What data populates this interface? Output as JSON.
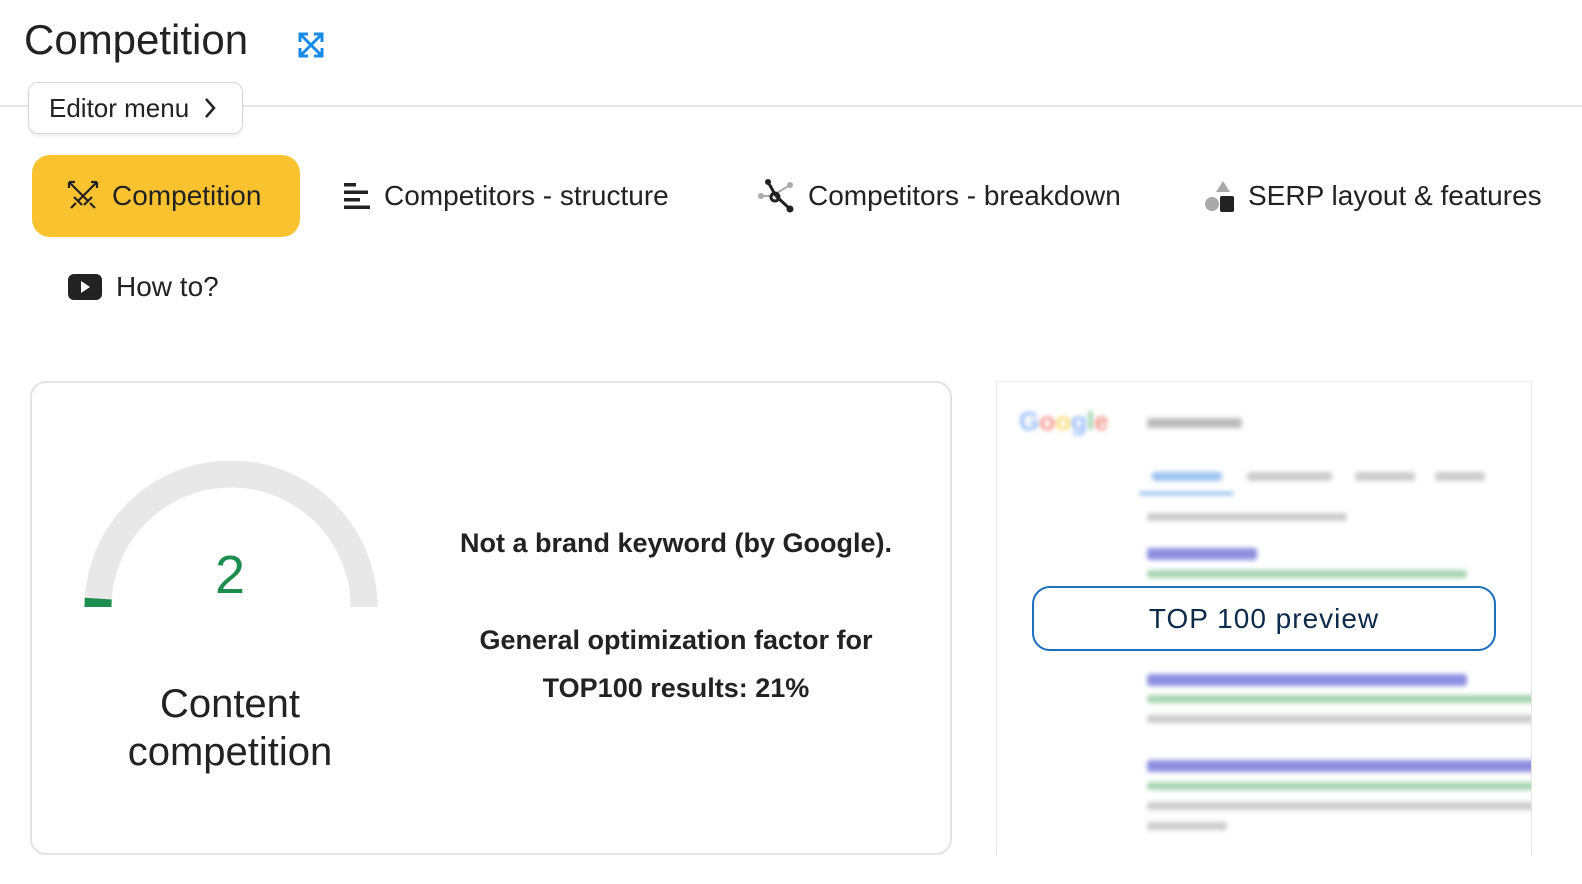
{
  "header": {
    "title": "Competition",
    "expand_icon": "expand-arrows-icon",
    "editor_menu": "Editor menu"
  },
  "tabs": [
    {
      "label": "Competition",
      "icon": "crossed-swords-icon",
      "active": true
    },
    {
      "label": "Competitors - structure",
      "icon": "align-left-lines-icon"
    },
    {
      "label": "Competitors - breakdown",
      "icon": "nodes-graph-icon"
    },
    {
      "label": "SERP layout & features",
      "icon": "shapes-icon"
    }
  ],
  "howto": {
    "label": "How to?",
    "icon": "youtube-play-icon"
  },
  "competition": {
    "gauge_value": 2,
    "gauge_max": 100,
    "gauge_color": "#1e8e4e",
    "value_text": "2",
    "label": "Content competition",
    "brand_text": "Not a brand keyword (by Google).",
    "factor_line1": "General optimization factor for",
    "factor_line2": "TOP100 results: 21%"
  },
  "preview": {
    "button": "TOP 100 preview",
    "logo": "Google"
  },
  "colors": {
    "accent": "#fbc22f",
    "link": "#1d6fc0"
  }
}
